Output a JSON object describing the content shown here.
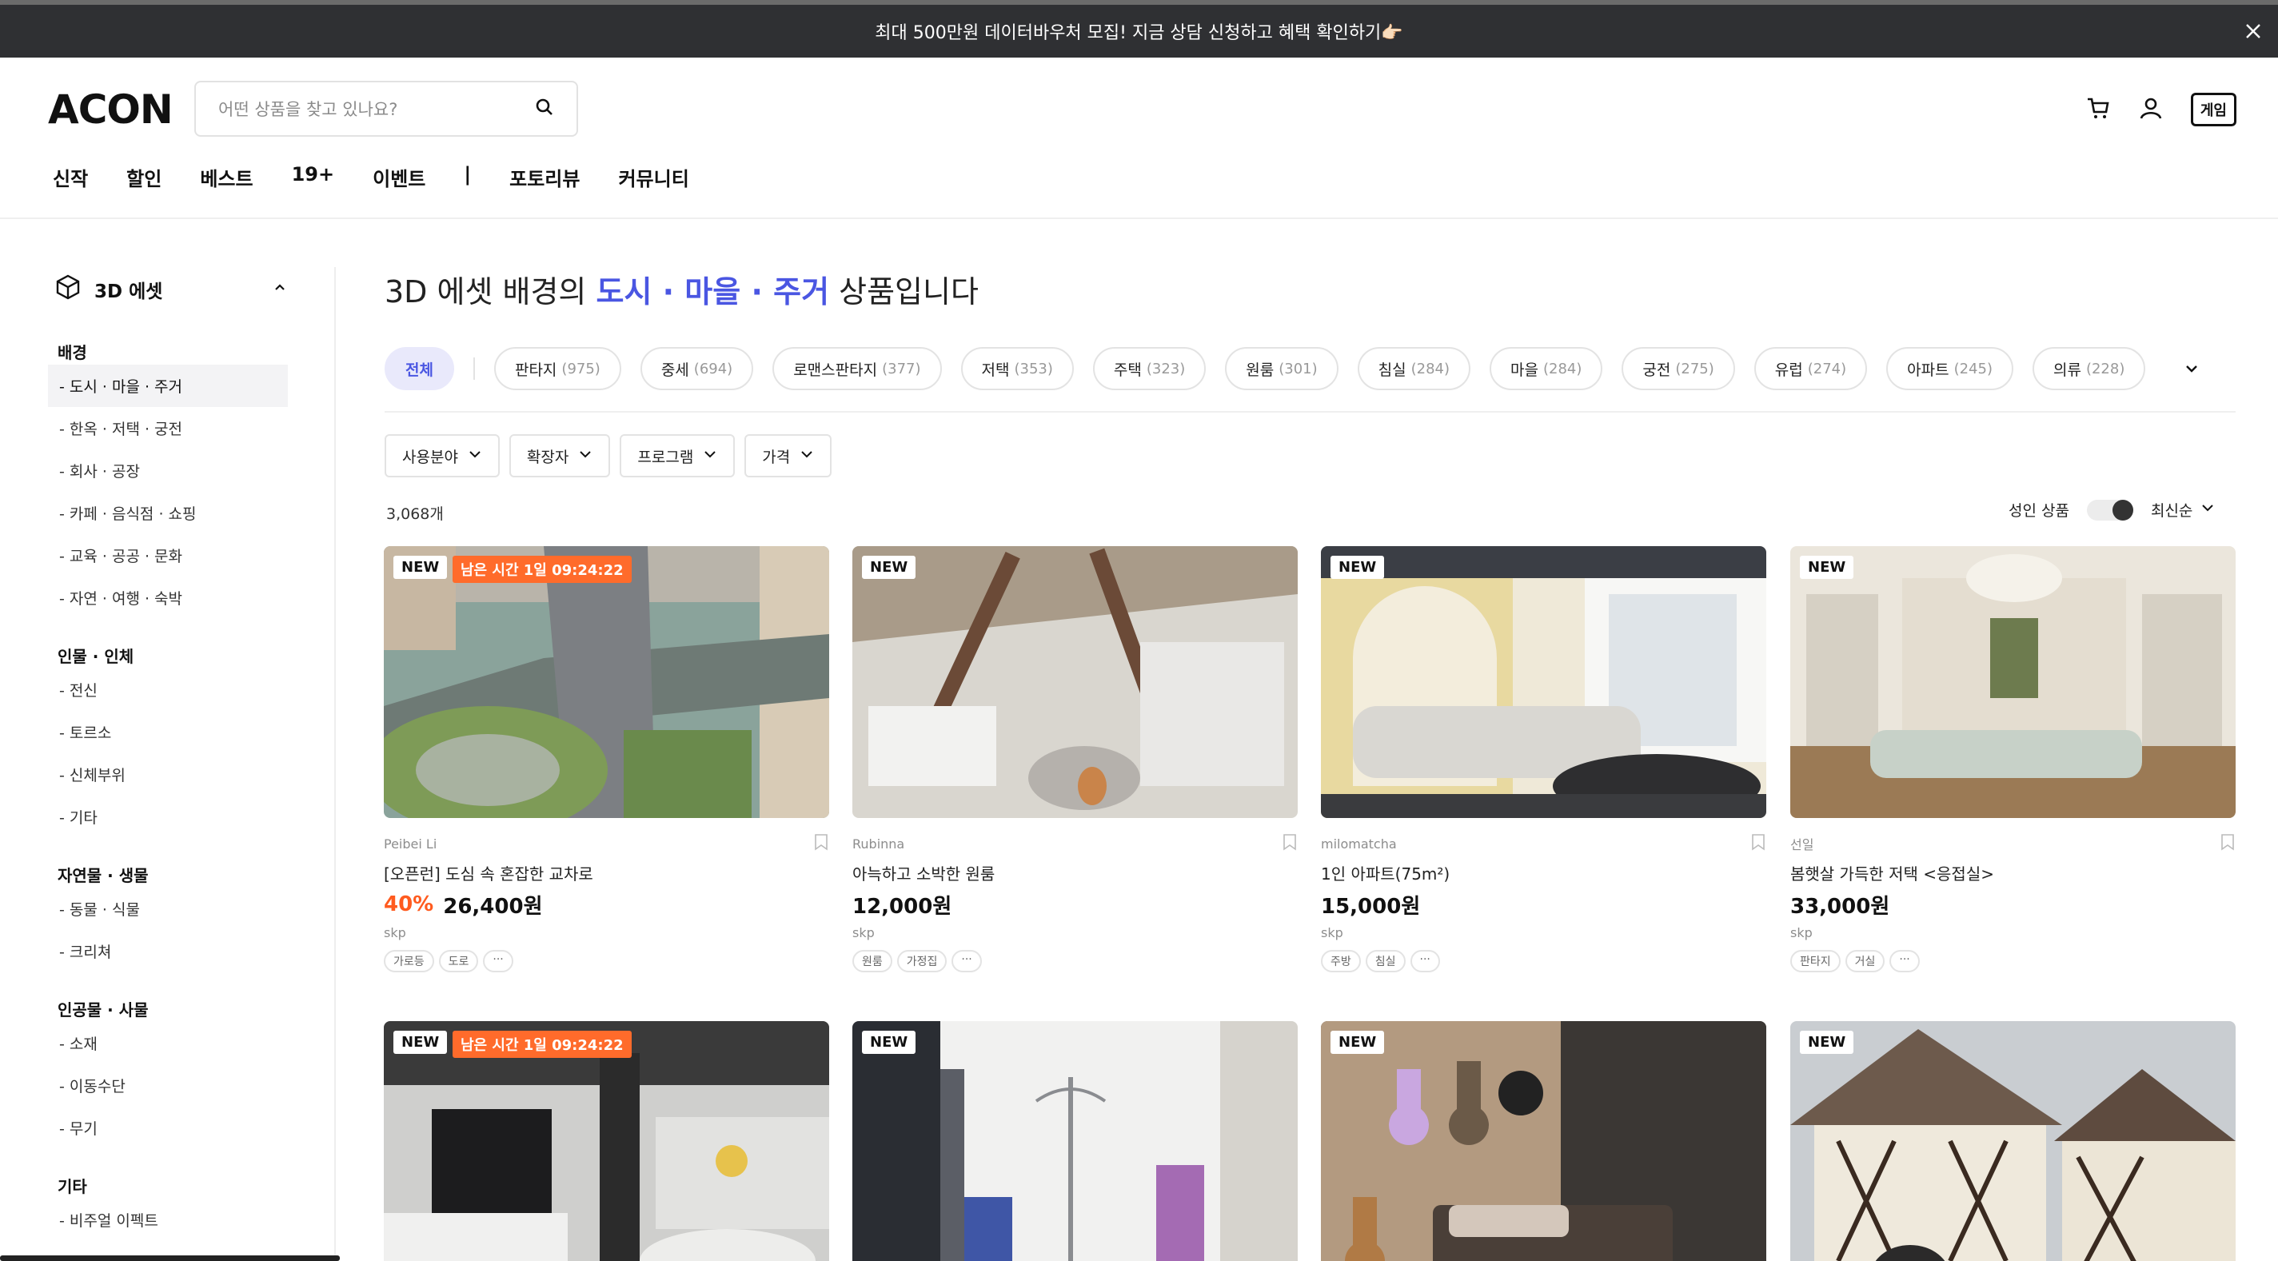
{
  "banner": {
    "text": "최대 500만원 데이터바우처 모집! 지금 상담 신청하고 혜택 확인하기👉🏻"
  },
  "header": {
    "logo": "ACON",
    "search_placeholder": "어떤 상품을 찾고 있나요?",
    "game_label": "게임",
    "nav": [
      "신작",
      "할인",
      "베스트",
      "19+",
      "이벤트",
      "|",
      "포토리뷰",
      "커뮤니티"
    ]
  },
  "sidebar": {
    "title": "3D 에셋",
    "groups": [
      {
        "label": "배경",
        "items": [
          "- 도시 · 마을 · 주거",
          "- 한옥 · 저택 · 궁전",
          "- 회사 · 공장",
          "- 카페 · 음식점 · 쇼핑",
          "- 교육 · 공공 · 문화",
          "- 자연 · 여행 · 숙박"
        ]
      },
      {
        "label": "인물 · 인체",
        "items": [
          "- 전신",
          "- 토르소",
          "- 신체부위",
          "- 기타"
        ]
      },
      {
        "label": "자연물 · 생물",
        "items": [
          "- 동물 · 식물",
          "- 크리쳐"
        ]
      },
      {
        "label": "인공물 · 사물",
        "items": [
          "- 소재",
          "- 이동수단",
          "- 무기"
        ]
      },
      {
        "label": "기타",
        "items": [
          "- 비주얼 이펙트"
        ]
      }
    ]
  },
  "main": {
    "title_pre": "3D 에셋 배경의 ",
    "title_accent": "도시 · 마을 · 주거",
    "title_post": " 상품입니다",
    "chips": [
      {
        "label": "전체",
        "count": ""
      },
      {
        "label": "판타지",
        "count": "(975)"
      },
      {
        "label": "중세",
        "count": "(694)"
      },
      {
        "label": "로맨스판타지",
        "count": "(377)"
      },
      {
        "label": "저택",
        "count": "(353)"
      },
      {
        "label": "주택",
        "count": "(323)"
      },
      {
        "label": "원룸",
        "count": "(301)"
      },
      {
        "label": "침실",
        "count": "(284)"
      },
      {
        "label": "마을",
        "count": "(284)"
      },
      {
        "label": "궁전",
        "count": "(275)"
      },
      {
        "label": "유럽",
        "count": "(274)"
      },
      {
        "label": "아파트",
        "count": "(245)"
      },
      {
        "label": "의류",
        "count": "(228)"
      }
    ],
    "filters": [
      "사용분야",
      "확장자",
      "프로그램",
      "가격"
    ],
    "count": "3,068개",
    "adult_label": "성인 상품",
    "sort_label": "최신순"
  },
  "products": [
    {
      "badge": "NEW",
      "timer": "남은 시간 1일 09:24:22",
      "author": "Peibei Li",
      "title": "[오픈런] 도심 속 혼잡한 교차로",
      "discount": "40%",
      "price": "26,400원",
      "ext": "skp",
      "tags": [
        "가로등",
        "도로",
        "···"
      ]
    },
    {
      "badge": "NEW",
      "timer": "",
      "author": "Rubinna",
      "title": "아늑하고 소박한 원룸",
      "discount": "",
      "price": "12,000원",
      "ext": "skp",
      "tags": [
        "원룸",
        "가정집",
        "···"
      ]
    },
    {
      "badge": "NEW",
      "timer": "",
      "author": "milomatcha",
      "title": "1인 아파트(75m²)",
      "discount": "",
      "price": "15,000원",
      "ext": "skp",
      "tags": [
        "주방",
        "침실",
        "···"
      ]
    },
    {
      "badge": "NEW",
      "timer": "",
      "author": "선일",
      "title": "봄햇살 가득한 저택 <응접실>",
      "discount": "",
      "price": "33,000원",
      "ext": "skp",
      "tags": [
        "판타지",
        "거실",
        "···"
      ]
    },
    {
      "badge": "NEW",
      "timer": "남은 시간 1일 09:24:22"
    },
    {
      "badge": "NEW",
      "timer": ""
    },
    {
      "badge": "NEW",
      "timer": ""
    },
    {
      "badge": "NEW",
      "timer": ""
    }
  ],
  "colors": {
    "accent": "#4a56e2",
    "discount": "#ff5b1f",
    "timer_badge": "#ff6b2b",
    "banner_bg": "#2f3033"
  }
}
